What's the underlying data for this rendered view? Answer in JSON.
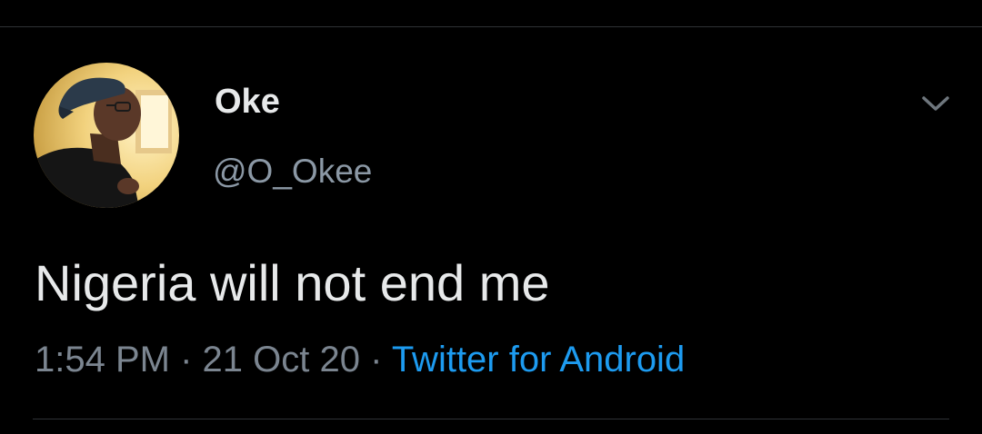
{
  "tweet": {
    "author": {
      "display_name": "Oke",
      "handle": "@O_Okee",
      "avatar_icon": "profile-photo"
    },
    "text": "Nigeria will not end me",
    "time": "1:54 PM",
    "date": "21 Oct 20",
    "separator": "·",
    "source": "Twitter for Android",
    "menu_icon": "chevron-down-icon"
  },
  "colors": {
    "background": "#000000",
    "primary_text": "#e7e9ea",
    "secondary_text": "#8b98a5",
    "link": "#1d9bf0",
    "divider": "#2f3336"
  }
}
